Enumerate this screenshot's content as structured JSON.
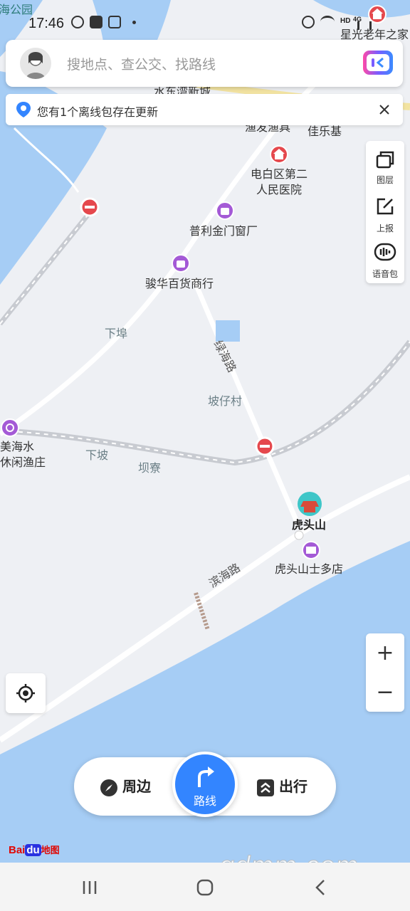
{
  "status_bar": {
    "time": "17:46",
    "net": "HD",
    "signal": "4G"
  },
  "search": {
    "placeholder": "搜地点、查公交、找路线"
  },
  "notice": {
    "text": "您有1个离线包存在更新"
  },
  "side_panel": [
    {
      "label": "图层",
      "icon": "layers-icon"
    },
    {
      "label": "上报",
      "icon": "report-icon"
    },
    {
      "label": "语音包",
      "icon": "voice-pack-icon"
    }
  ],
  "zoom": {
    "in": "+",
    "out": "−"
  },
  "bottom_bar": {
    "nearby": "周边",
    "route": "路线",
    "travel": "出行"
  },
  "logo": {
    "baidu": "Bai",
    "du": "du",
    "map": "地图"
  },
  "watermark": "gdmm.com",
  "map": {
    "labels": {
      "park_partial": "海公园",
      "elderly_home": "星光老年之家",
      "shuidong_new_city": "水东湾新城",
      "fishery_partial": "渔发渔具",
      "jialeji": "佳乐基",
      "hospital": "电白区第二人民医院",
      "hospital_line1": "电白区第二",
      "hospital_line2": "人民医院",
      "shop1": "普利金门窗厂",
      "shop2": "骏华百货商行",
      "xiabu": "下埠",
      "road_lvhai": "绿海路",
      "pozaicun": "坡仔村",
      "meihai_line1": "美海水",
      "meihai_line2": "休闲渔庄",
      "xiapo": "下坡",
      "bazhai": "坝寮",
      "hutoushan": "虎头山",
      "store": "虎头山士多店",
      "road_binhai": "滨海路"
    },
    "colors": {
      "water": "#a6cdf5",
      "land": "#eef0f4",
      "road": "#ffffff",
      "rail": "#c8cbd1",
      "poi_purple": "#a45ad6",
      "hospital_red": "#e5484d",
      "accent_blue": "#3385ff"
    }
  }
}
